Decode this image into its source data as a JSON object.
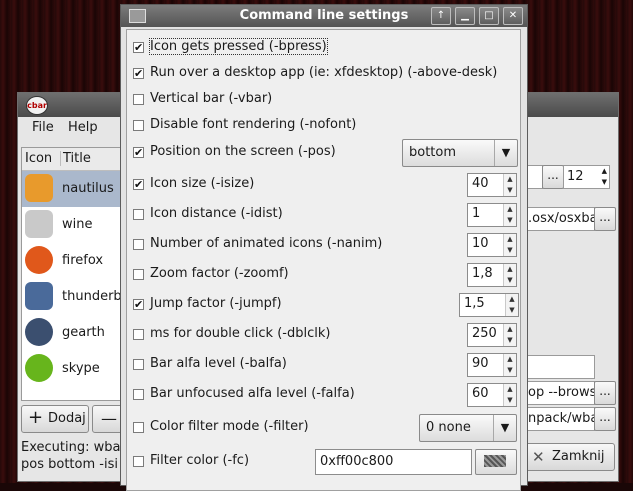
{
  "background_window": {
    "logo": "cbar",
    "menu": [
      "File",
      "Help"
    ],
    "list_headers": {
      "icon": "Icon",
      "title": "Title"
    },
    "items": [
      {
        "name": "nautilus",
        "icon": "drive-icon",
        "color": "#e89a2c"
      },
      {
        "name": "wine",
        "icon": "gamepad-icon",
        "color": "#c9c9c9"
      },
      {
        "name": "firefox",
        "icon": "firefox-icon",
        "color": "#e0581b"
      },
      {
        "name": "thunderbi",
        "icon": "thunderbird-icon",
        "color": "#4a6a9a"
      },
      {
        "name": "gearth",
        "icon": "globe-icon",
        "color": "#3b4f6f"
      },
      {
        "name": "skype",
        "icon": "skype-icon",
        "color": "#67b51c"
      }
    ],
    "add_button": "Dodaj",
    "close_button": "Zamknij",
    "status_line_1": "Executing: wba",
    "status_line_2": "pos bottom -isi",
    "right_size_value": "12",
    "right_field_1": ".osx/osxba",
    "right_field_2": "op --brows",
    "right_field_3": "npack/wba",
    "dots": "..."
  },
  "dialog": {
    "title": "Command line settings",
    "options": [
      {
        "label": "Icon gets pressed (-bpress)",
        "checked": true
      },
      {
        "label": "Run over a desktop app (ie: xfdesktop) (-above-desk)",
        "checked": true
      },
      {
        "label": "Vertical bar (-vbar)",
        "checked": false
      },
      {
        "label": "Disable font rendering (-nofont)",
        "checked": false
      },
      {
        "label": "Position on the screen (-pos)",
        "checked": true,
        "value": "bottom"
      },
      {
        "label": "Icon size (-isize)",
        "checked": true,
        "value": "40"
      },
      {
        "label": "Icon distance (-idist)",
        "checked": false,
        "value": "1"
      },
      {
        "label": "Number of animated icons (-nanim)",
        "checked": false,
        "value": "10"
      },
      {
        "label": "Zoom factor (-zoomf)",
        "checked": false,
        "value": "1,8"
      },
      {
        "label": "Jump factor (-jumpf)",
        "checked": true,
        "value": "1,5"
      },
      {
        "label": "ms for double click (-dblclk)",
        "checked": false,
        "value": "250"
      },
      {
        "label": "Bar alfa level (-balfa)",
        "checked": false,
        "value": "90"
      },
      {
        "label": "Bar unfocused alfa level (-falfa)",
        "checked": false,
        "value": "60"
      },
      {
        "label": "Color filter mode (-filter)",
        "checked": false,
        "value": "0 none"
      },
      {
        "label": "Filter color (-fc)",
        "checked": false,
        "value": "0xff00c800"
      }
    ]
  }
}
